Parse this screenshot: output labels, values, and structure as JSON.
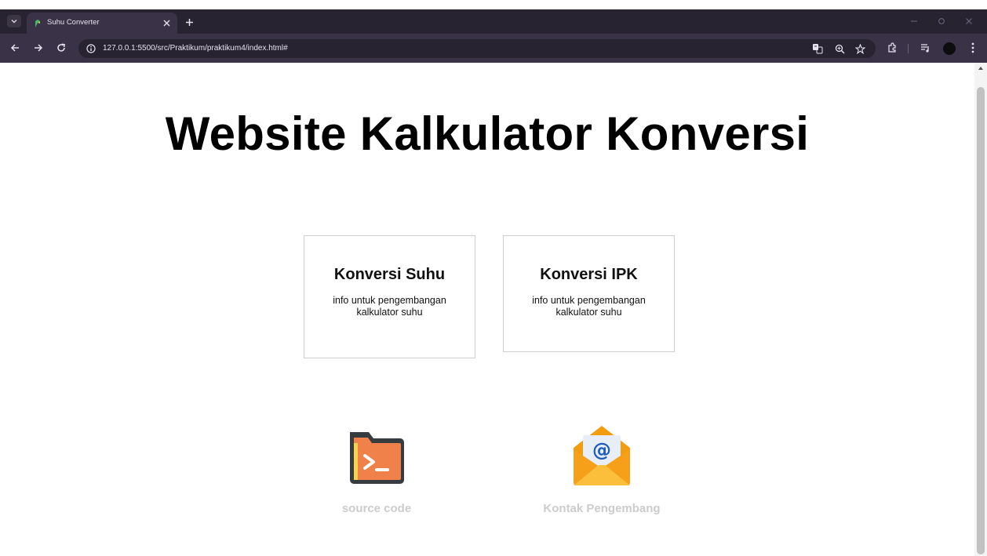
{
  "browser": {
    "tab": {
      "title": "Suhu Converter",
      "favicon": "page-favicon-icon"
    },
    "address_bar": {
      "url": "127.0.0.1:5500/src/Praktikum/praktikum4/index.html#"
    },
    "icons": [
      "tab-list-icon",
      "close-icon",
      "plus-icon",
      "minimize-icon",
      "restore-icon",
      "window-close-icon",
      "back-icon",
      "forward-icon",
      "reload-icon",
      "site-info-icon",
      "translate-icon",
      "zoom-icon",
      "star-icon",
      "extensions-icon",
      "media-icon",
      "profile-avatar",
      "more-menu-icon"
    ]
  },
  "page": {
    "title": "Website Kalkulator Konversi",
    "cards": [
      {
        "title": "Konversi Suhu",
        "description": "info untuk pengembangan kalkulator suhu"
      },
      {
        "title": "Konversi IPK",
        "description": "info untuk pengembangan kalkulator suhu"
      }
    ],
    "links": [
      {
        "label": "source code",
        "icon": "terminal-folder-icon"
      },
      {
        "label": "Kontak Pengembang",
        "icon": "email-envelope-icon"
      }
    ]
  },
  "colors": {
    "chrome_dark": "#282331",
    "chrome_toolbar": "#3a3348",
    "link_label": "#cccccc",
    "folder_orange": "#f0814a",
    "envelope_orange": "#f6a01a",
    "email_blue": "#1d5bbf"
  }
}
